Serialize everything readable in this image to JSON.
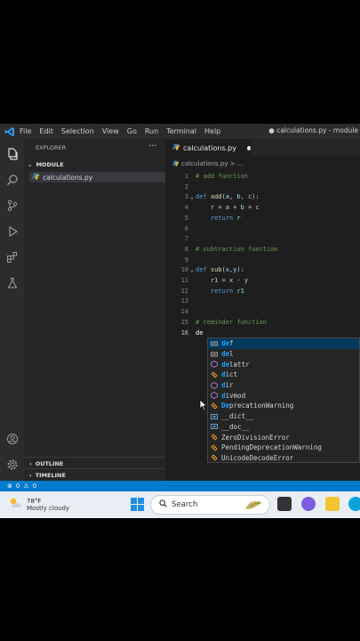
{
  "window": {
    "title": "● calculations.py - module",
    "menu": [
      "File",
      "Edit",
      "Selection",
      "View",
      "Go",
      "Run",
      "Terminal",
      "Help"
    ]
  },
  "activity_bar": {
    "icons": [
      "files-icon",
      "search-icon",
      "source-control-icon",
      "run-debug-icon",
      "extensions-icon",
      "testing-icon",
      "account-icon",
      "settings-gear-icon"
    ]
  },
  "sidebar": {
    "header": "EXPLORER",
    "more": "···",
    "folder": "MODULE",
    "file": "calculations.py",
    "outline": "OUTLINE",
    "timeline": "TIMELINE"
  },
  "editor": {
    "tab_label": "calculations.py",
    "breadcrumb": "calculations.py > ...",
    "lines": [
      {
        "n": "1",
        "fold": "",
        "parts": [
          {
            "c": "cm",
            "t": "# add function"
          }
        ]
      },
      {
        "n": "2",
        "fold": "",
        "parts": []
      },
      {
        "n": "3",
        "fold": "⌄",
        "parts": [
          {
            "c": "kw",
            "t": "def "
          },
          {
            "c": "fn",
            "t": "add"
          },
          {
            "c": "",
            "t": "("
          },
          {
            "c": "pm",
            "t": "a"
          },
          {
            "c": "",
            "t": ", "
          },
          {
            "c": "pm",
            "t": "b"
          },
          {
            "c": "",
            "t": ", "
          },
          {
            "c": "pm",
            "t": "c"
          },
          {
            "c": "",
            "t": "):"
          }
        ]
      },
      {
        "n": "4",
        "fold": "",
        "parts": [
          {
            "c": "",
            "t": "    "
          },
          {
            "c": "pm",
            "t": "r"
          },
          {
            "c": "",
            "t": " = "
          },
          {
            "c": "pm",
            "t": "a"
          },
          {
            "c": "",
            "t": " + "
          },
          {
            "c": "pm",
            "t": "b"
          },
          {
            "c": "",
            "t": " + "
          },
          {
            "c": "pm",
            "t": "c"
          }
        ]
      },
      {
        "n": "5",
        "fold": "",
        "parts": [
          {
            "c": "",
            "t": "    "
          },
          {
            "c": "kw",
            "t": "return "
          },
          {
            "c": "pm",
            "t": "r"
          }
        ]
      },
      {
        "n": "6",
        "fold": "",
        "parts": []
      },
      {
        "n": "7",
        "fold": "",
        "parts": []
      },
      {
        "n": "8",
        "fold": "",
        "parts": [
          {
            "c": "cm",
            "t": "# subtraction function"
          }
        ]
      },
      {
        "n": "9",
        "fold": "",
        "parts": []
      },
      {
        "n": "10",
        "fold": "⌄",
        "parts": [
          {
            "c": "kw",
            "t": "def "
          },
          {
            "c": "fn",
            "t": "sub"
          },
          {
            "c": "",
            "t": "("
          },
          {
            "c": "pm",
            "t": "x"
          },
          {
            "c": "",
            "t": ","
          },
          {
            "c": "pm",
            "t": "y"
          },
          {
            "c": "",
            "t": "):"
          }
        ]
      },
      {
        "n": "11",
        "fold": "",
        "parts": [
          {
            "c": "",
            "t": "    "
          },
          {
            "c": "pm",
            "t": "r1"
          },
          {
            "c": "",
            "t": " = "
          },
          {
            "c": "pm",
            "t": "x"
          },
          {
            "c": "",
            "t": " - "
          },
          {
            "c": "pm",
            "t": "y"
          }
        ]
      },
      {
        "n": "12",
        "fold": "",
        "parts": [
          {
            "c": "",
            "t": "    "
          },
          {
            "c": "kw",
            "t": "return "
          },
          {
            "c": "pm",
            "t": "r1"
          }
        ]
      },
      {
        "n": "13",
        "fold": "",
        "parts": []
      },
      {
        "n": "14",
        "fold": "",
        "parts": []
      },
      {
        "n": "15",
        "fold": "",
        "parts": [
          {
            "c": "cm",
            "t": "# reminder function"
          }
        ]
      },
      {
        "n": "16",
        "fold": "",
        "parts": [
          {
            "c": "cur",
            "t": "de"
          }
        ]
      }
    ]
  },
  "suggestions": [
    {
      "icon": "keyword-icon",
      "label": "def",
      "match": "de",
      "rest": "f",
      "selected": true
    },
    {
      "icon": "keyword-icon",
      "label": "del",
      "match": "de",
      "rest": "l"
    },
    {
      "icon": "function-icon",
      "label": "delattr",
      "match": "de",
      "rest": "lattr"
    },
    {
      "icon": "class-icon",
      "label": "dict",
      "match": "d",
      "rest": "ict"
    },
    {
      "icon": "function-icon",
      "label": "dir",
      "match": "d",
      "rest": "ir"
    },
    {
      "icon": "function-icon",
      "label": "divmod",
      "match": "d",
      "rest": "ivmod"
    },
    {
      "icon": "class-icon",
      "label": "DeprecationWarning",
      "match": "De",
      "rest": "precationWarning"
    },
    {
      "icon": "variable-icon",
      "label": "__dict__",
      "match": "",
      "rest": "__dict__"
    },
    {
      "icon": "variable-icon",
      "label": "__doc__",
      "match": "",
      "rest": "__doc__"
    },
    {
      "icon": "class-icon",
      "label": "ZeroDivisionError",
      "match": "",
      "rest": "ZeroDivisionError"
    },
    {
      "icon": "class-icon",
      "label": "PendingDeprecationWarning",
      "match": "",
      "rest": "PendingDeprecationWarning"
    },
    {
      "icon": "class-icon",
      "label": "UnicodeDecodeError",
      "match": "",
      "rest": "UnicodeDecodeError"
    }
  ],
  "statusbar": {
    "errors": "0",
    "warnings": "0"
  },
  "taskbar": {
    "temperature": "78°F",
    "condition": "Mostly cloudy",
    "search_placeholder": "Search"
  },
  "colors": {
    "accent": "#007acc",
    "keyword": "#569cd6",
    "comment": "#6a9955",
    "selection": "#04395e"
  }
}
